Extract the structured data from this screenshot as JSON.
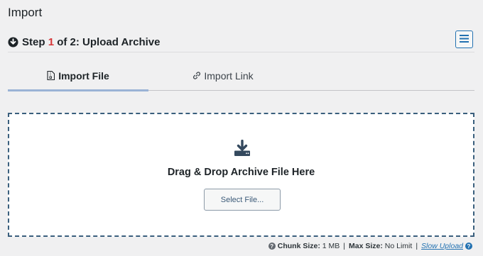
{
  "page": {
    "title": "Import"
  },
  "step": {
    "prefix": "Step ",
    "number": "1",
    "suffix": " of 2: Upload Archive",
    "icon": "download-circle-icon"
  },
  "menu": {
    "icon": "hamburger-menu-icon"
  },
  "tabs": [
    {
      "label": "Import File",
      "icon": "file-zip-icon",
      "active": true
    },
    {
      "label": "Import Link",
      "icon": "link-icon",
      "active": false
    }
  ],
  "dropzone": {
    "icon": "download-tray-icon",
    "text": "Drag & Drop Archive File Here",
    "button_label": "Select File..."
  },
  "footer": {
    "chunk_label": "Chunk Size:",
    "chunk_value": " 1 MB",
    "sep": "|",
    "max_label": "Max Size:",
    "max_value": " No Limit",
    "sep2": "|",
    "slow_upload": "Slow Upload",
    "help_glyph": "?"
  },
  "colors": {
    "accent": "#2271b1",
    "step_number": "#d63638",
    "dashed_border": "#3a5f7d",
    "tab_underline": "#9ab3d6"
  }
}
